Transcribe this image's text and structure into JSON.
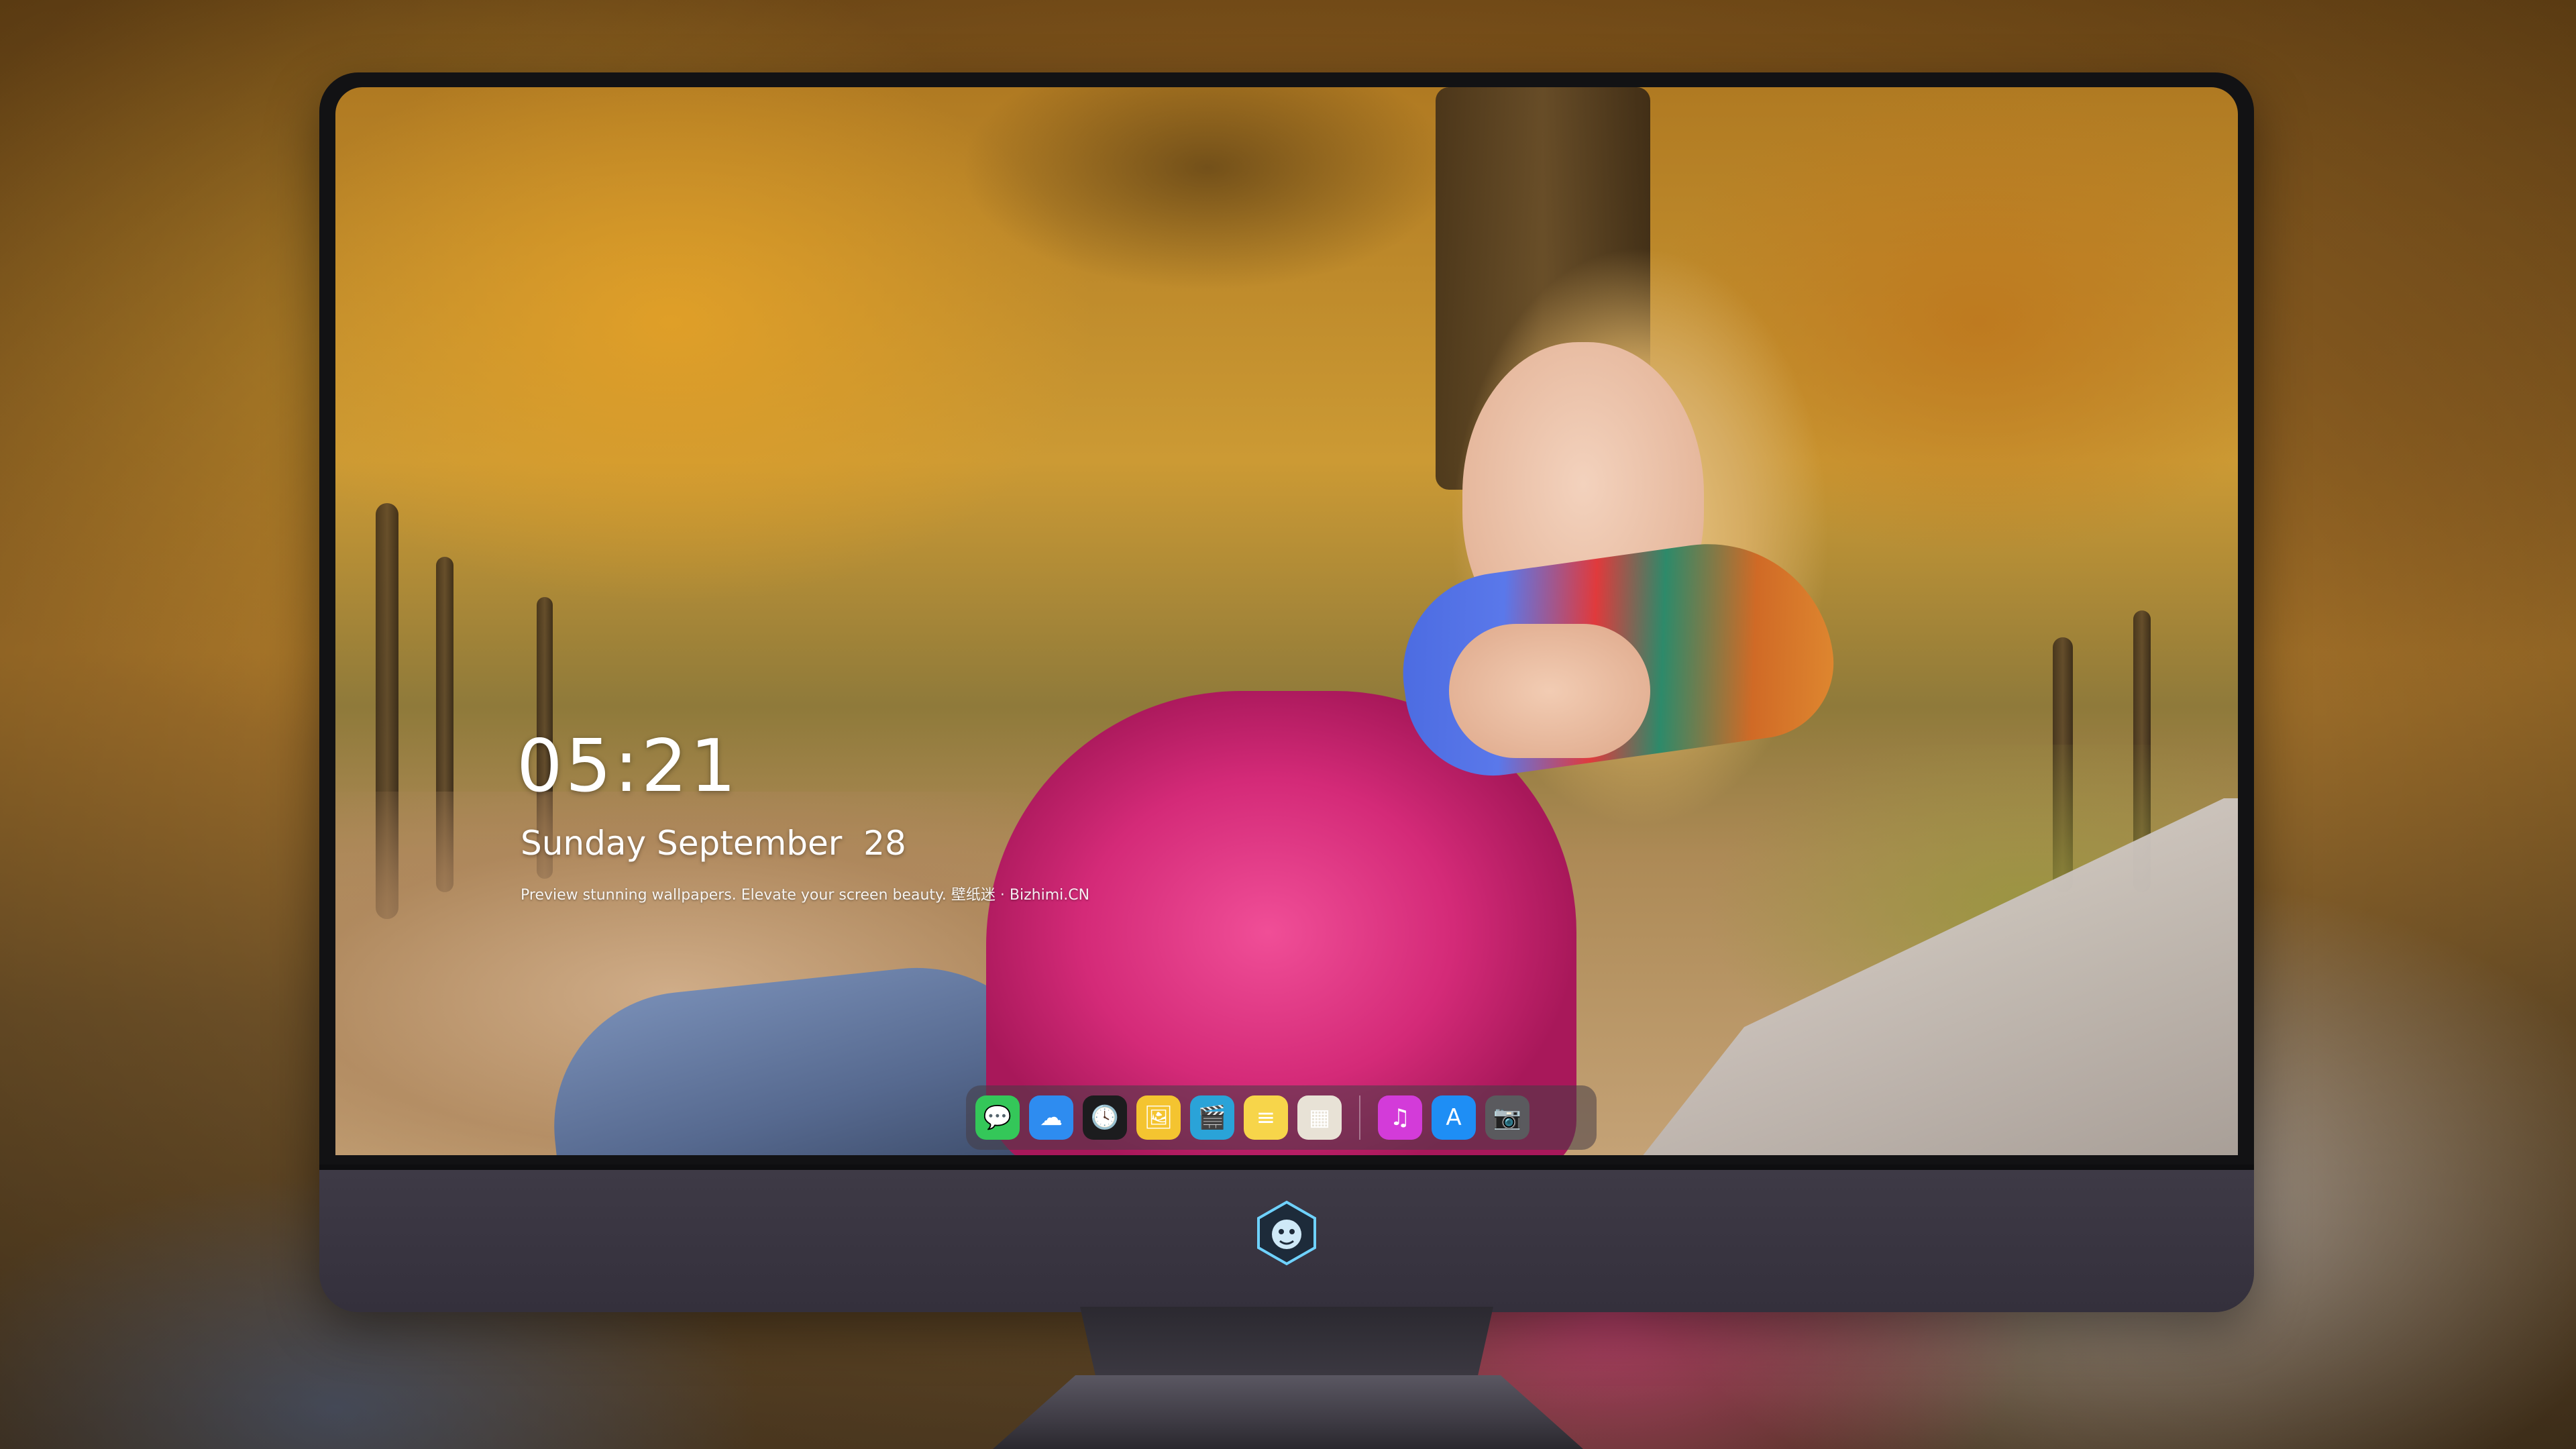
{
  "lock_screen": {
    "time": "05:21",
    "date": "Sunday September  28",
    "tagline": "Preview stunning wallpapers. Elevate your screen beauty. 壁纸迷 · Bizhimi.CN"
  },
  "dock": {
    "apps": [
      {
        "name": "Messages",
        "icon": "messages-icon",
        "glyph": "💬",
        "color": "#34c759"
      },
      {
        "name": "Weather",
        "icon": "weather-icon",
        "glyph": "☁",
        "color": "#2e8cf0"
      },
      {
        "name": "Clock",
        "icon": "clock-icon",
        "glyph": "🕓",
        "color": "#1c1c1e"
      },
      {
        "name": "Preview",
        "icon": "preview-icon",
        "glyph": "🖼",
        "color": "#f4c430"
      },
      {
        "name": "Clips",
        "icon": "clips-icon",
        "glyph": "🎬",
        "color": "#2aa3d8"
      },
      {
        "name": "Notes",
        "icon": "notes-icon",
        "glyph": "≡",
        "color": "#f7d54a"
      },
      {
        "name": "Photo Booth",
        "icon": "photobooth-icon",
        "glyph": "▦",
        "color": "#e8e2d6"
      },
      {
        "name": "iTunes",
        "icon": "music-icon",
        "glyph": "♫",
        "color": "#d33bd9"
      },
      {
        "name": "App Store",
        "icon": "appstore-icon",
        "glyph": "A",
        "color": "#1e8ef5"
      },
      {
        "name": "Camera",
        "icon": "camera-icon",
        "glyph": "📷",
        "color": "#5a5a5e"
      }
    ]
  },
  "colors": {
    "bezel": "#121214",
    "chin": "#3e3a46",
    "jacket_pink": "#e03a88",
    "scarf_blue": "#4a6ae0",
    "foliage": "#cc9a34"
  }
}
